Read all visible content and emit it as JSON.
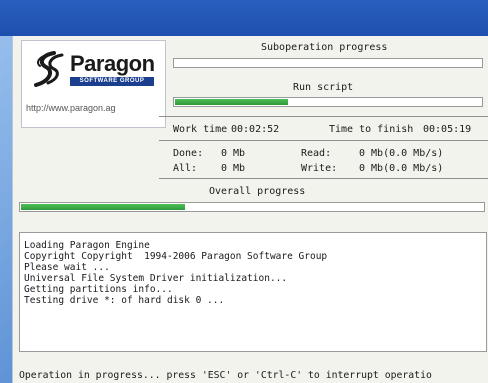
{
  "brand": {
    "name": "Paragon",
    "subtitle": "SOFTWARE GROUP",
    "url": "http://www.paragon.ag",
    "colors": {
      "navy": "#1b3f8f",
      "accent": "#1e4fae"
    }
  },
  "suboperation": {
    "label": "Suboperation progress",
    "progress": 0
  },
  "current_task": {
    "label": "Run script",
    "progress": 0.37
  },
  "timing": {
    "work_label": "Work time",
    "work_value": "00:02:52",
    "finish_label": "Time to finish",
    "finish_value": "00:05:19"
  },
  "stats": {
    "done_label": "Done:",
    "done_value": "0 Mb",
    "all_label": "All:",
    "all_value": "0 Mb",
    "read_label": "Read:",
    "read_value": "0 Mb(0.0 Mb/s)",
    "write_label": "Write:",
    "write_value": "0 Mb(0.0 Mb/s)"
  },
  "overall": {
    "label": "Overall progress",
    "progress": 0.355
  },
  "log": [
    "Loading Paragon Engine",
    "Copyright Copyright  1994-2006 Paragon Software Group",
    "Please wait ...",
    "Universal File System Driver initialization...",
    "Getting partitions info...",
    "Testing drive *: of hard disk 0 ..."
  ],
  "status_text": "Operation in progress... press 'ESC' or 'Ctrl-C' to interrupt operatio"
}
